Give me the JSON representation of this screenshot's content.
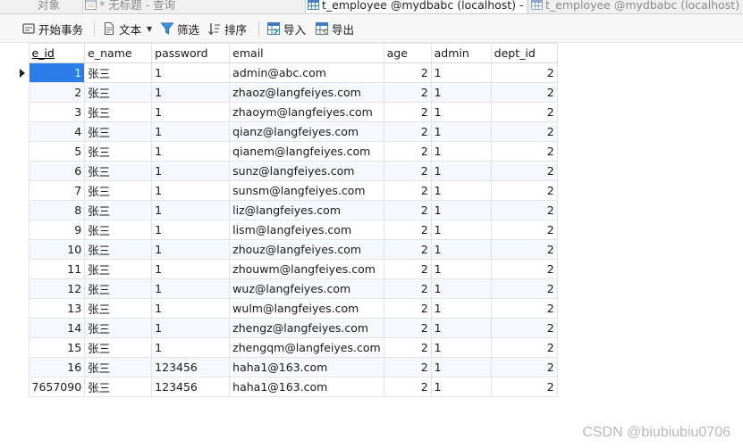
{
  "tabs": [
    {
      "label": "对象",
      "active": false
    },
    {
      "label": "* 无标题 - 查询",
      "active": false
    },
    {
      "label": "t_employee @mydbabc (localhost) - ...",
      "active": true
    },
    {
      "label": "t_employee @mydbabc (localhost) - ...",
      "active": false
    }
  ],
  "toolbar": {
    "begin_transaction": "开始事务",
    "text": "文本",
    "filter": "筛选",
    "sort": "排序",
    "import": "导入",
    "export": "导出"
  },
  "grid": {
    "columns": [
      "e_id",
      "e_name",
      "password",
      "email",
      "age",
      "admin",
      "dept_id"
    ],
    "rows": [
      [
        "1",
        "张三",
        "1",
        "admin@abc.com",
        "2",
        "1",
        "2"
      ],
      [
        "2",
        "张三",
        "1",
        "zhaoz@langfeiyes.com",
        "2",
        "1",
        "2"
      ],
      [
        "3",
        "张三",
        "1",
        "zhaoym@langfeiyes.com",
        "2",
        "1",
        "2"
      ],
      [
        "4",
        "张三",
        "1",
        "qianz@langfeiyes.com",
        "2",
        "1",
        "2"
      ],
      [
        "5",
        "张三",
        "1",
        "qianem@langfeiyes.com",
        "2",
        "1",
        "2"
      ],
      [
        "6",
        "张三",
        "1",
        "sunz@langfeiyes.com",
        "2",
        "1",
        "2"
      ],
      [
        "7",
        "张三",
        "1",
        "sunsm@langfeiyes.com",
        "2",
        "1",
        "2"
      ],
      [
        "8",
        "张三",
        "1",
        "liz@langfeiyes.com",
        "2",
        "1",
        "2"
      ],
      [
        "9",
        "张三",
        "1",
        "lism@langfeiyes.com",
        "2",
        "1",
        "2"
      ],
      [
        "10",
        "张三",
        "1",
        "zhouz@langfeiyes.com",
        "2",
        "1",
        "2"
      ],
      [
        "11",
        "张三",
        "1",
        "zhouwm@langfeiyes.com",
        "2",
        "1",
        "2"
      ],
      [
        "12",
        "张三",
        "1",
        "wuz@langfeiyes.com",
        "2",
        "1",
        "2"
      ],
      [
        "13",
        "张三",
        "1",
        "wulm@langfeiyes.com",
        "2",
        "1",
        "2"
      ],
      [
        "14",
        "张三",
        "1",
        "zhengz@langfeiyes.com",
        "2",
        "1",
        "2"
      ],
      [
        "15",
        "张三",
        "1",
        "zhengqm@langfeiyes.com",
        "2",
        "1",
        "2"
      ],
      [
        "16",
        "张三",
        "123456",
        "haha1@163.com",
        "2",
        "1",
        "2"
      ],
      [
        "7657090",
        "张三",
        "123456",
        "haha1@163.com",
        "2",
        "1",
        "2"
      ]
    ]
  },
  "watermark": "CSDN @biubiubiu0706",
  "colors": {
    "selection": "#2b7de9",
    "stripe": "#f5f8fd"
  }
}
